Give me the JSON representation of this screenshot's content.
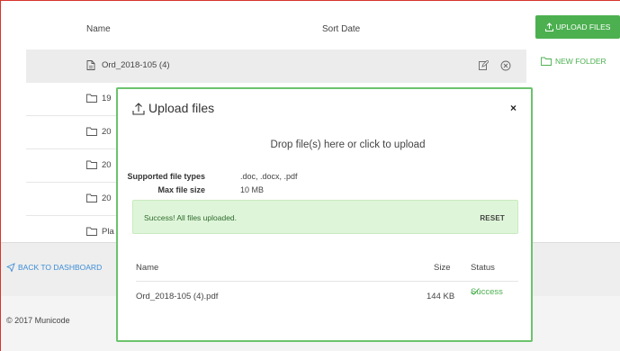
{
  "list": {
    "columns": {
      "name": "Name",
      "sort_date": "Sort Date"
    },
    "rows": [
      {
        "label": "Ord_2018-105 (4)",
        "icon": "document-icon",
        "selected": true
      },
      {
        "label": "19",
        "icon": "folder-icon"
      },
      {
        "label": "20",
        "icon": "folder-icon"
      },
      {
        "label": "20",
        "icon": "folder-icon"
      },
      {
        "label": "20",
        "icon": "folder-icon"
      },
      {
        "label": "Pla",
        "icon": "folder-icon"
      }
    ]
  },
  "actions": {
    "upload_files": "UPLOAD FILES",
    "new_folder": "NEW FOLDER"
  },
  "footer": {
    "back_link": "BACK TO DASHBOARD",
    "copyright": "© 2017 Municode"
  },
  "modal": {
    "title": "Upload files",
    "close": "×",
    "dropzone": "Drop file(s) here or click to upload",
    "supported_label": "Supported file types",
    "supported_value": ".doc, .docx, .pdf",
    "max_label": "Max file size",
    "max_value": "10 MB",
    "success_message": "Success! All files uploaded.",
    "reset": "RESET",
    "table": {
      "headers": {
        "name": "Name",
        "size": "Size",
        "status": "Status"
      },
      "files": [
        {
          "name": "Ord_2018-105 (4).pdf",
          "size": "144 KB",
          "status": "Success"
        }
      ]
    }
  },
  "colors": {
    "accent_green": "#4cb050",
    "link_blue": "#3c8dd6",
    "success_bg": "#dff5d9",
    "modal_border": "#6cc36c"
  }
}
